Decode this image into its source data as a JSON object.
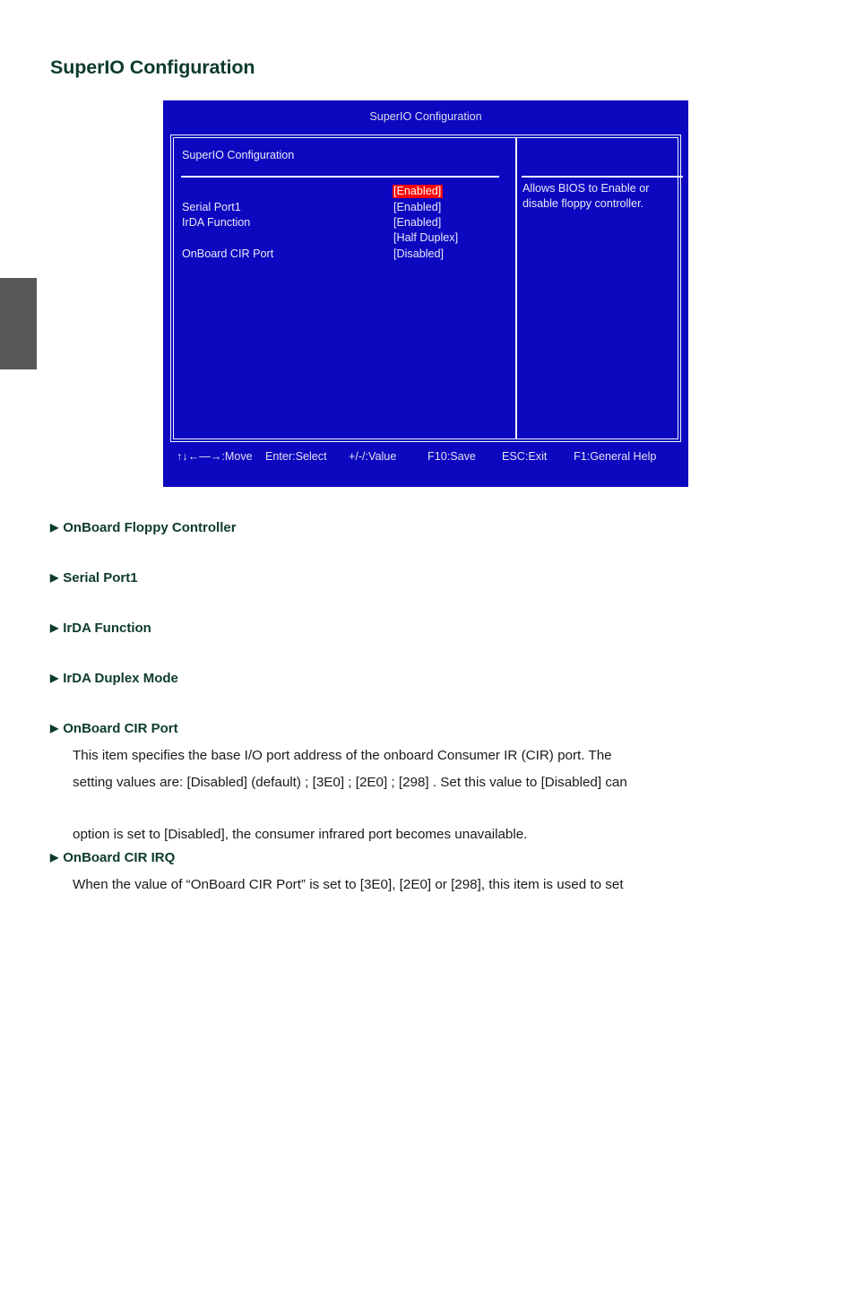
{
  "page": {
    "title": "SuperIO Configuration"
  },
  "bios": {
    "window_title": "SuperIO Configuration",
    "section_label": "SuperIO Configuration",
    "accent_highlight_color": "#FE0000",
    "screen_bg_color": "#0D07BF",
    "text_color": "#E8E8F6",
    "options": [
      {
        "label": "",
        "value": "[Enabled]",
        "highlighted": true
      },
      {
        "label": "Serial Port1",
        "value": "[Enabled]",
        "highlighted": false
      },
      {
        "label": "IrDA Function",
        "value": "[Enabled]",
        "highlighted": false
      },
      {
        "label": "",
        "value": "[Half Duplex]",
        "highlighted": false
      },
      {
        "label": "OnBoard CIR Port",
        "value": "[Disabled]",
        "highlighted": false
      }
    ],
    "help_text": "Allows BIOS to Enable or disable floppy controller.",
    "hints": [
      "↑↓←—→:Move",
      "Enter:Select",
      "+/-/:Value",
      "F10:Save",
      "ESC:Exit",
      "F1:General Help"
    ]
  },
  "sections": [
    {
      "heading": "OnBoard Floppy Controller",
      "lines": []
    },
    {
      "heading": "Serial Port1",
      "lines": []
    },
    {
      "heading": "IrDA Function",
      "lines": []
    },
    {
      "heading": "IrDA Duplex Mode",
      "lines": []
    },
    {
      "heading": "OnBoard CIR Port",
      "lines": [
        "This item specifies the base I/O port address of the onboard Consumer IR (CIR) port. The",
        "setting values are: [Disabled] (default) ; [3E0] ; [2E0] ; [298] . Set this value to [Disabled] can",
        "",
        "option is set to [Disabled], the consumer infrared port becomes unavailable."
      ]
    },
    {
      "heading": "OnBoard CIR IRQ",
      "lines": [
        "When the value of “OnBoard CIR Port” is set to [3E0], [2E0] or [298], this item is used to set"
      ]
    }
  ],
  "bullet_glyph": "▶"
}
